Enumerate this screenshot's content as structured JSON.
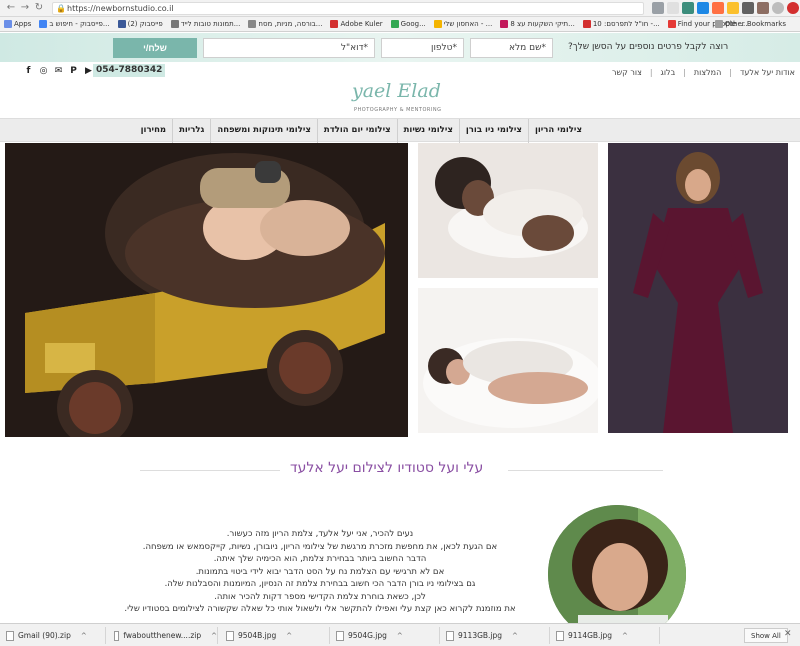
{
  "browser": {
    "url": "https://newbornstudio.co.il",
    "bookmarks": [
      {
        "label": "Apps",
        "color": "#6b8fe8"
      },
      {
        "label": "פייסבוק - חיפוש ב...",
        "color": "#4285f4"
      },
      {
        "label": "(2) פייסבוק",
        "color": "#3b5998"
      },
      {
        "label": "תמונות טובות לייד...",
        "color": "#777777"
      },
      {
        "label": "בורסה, מניות, מסח...",
        "color": "#888888"
      },
      {
        "label": "Adobe Kuler",
        "color": "#d32f2f"
      },
      {
        "label": "Goog...",
        "color": "#34a853"
      },
      {
        "label": "האחסון שלי - ...",
        "color": "#f4b400"
      },
      {
        "label": "8 תיקי השקעות עצ...",
        "color": "#c2185b"
      },
      {
        "label": "חו\"ל לתפרסם: 10 -...",
        "color": "#d32f2f"
      },
      {
        "label": "Find your people -...",
        "color": "#e53935"
      }
    ],
    "other_bookmarks": "Other Bookmarks"
  },
  "lead_form": {
    "question": "רוצה לקבל פרטים נוספים על הסשן שלך?",
    "name_placeholder": "שם מלא*",
    "phone_placeholder": "טלפון*",
    "email_placeholder": "דוא\"ל*",
    "submit_label": "שלח/י"
  },
  "header": {
    "phone": "054-7880342",
    "top_links": [
      "אודות יעל אלעד",
      "המלצות",
      "בלוג",
      "צור קשר"
    ],
    "logo_main": "yael Elad",
    "logo_sub": "PHOTOGRAPHY & MENTORING"
  },
  "nav": {
    "items": [
      "צילומי הריון",
      "צילומי ניו בורן",
      "צילומי נשיות",
      "צילומי יום הולדת",
      "צילומי תינוקות ומשפחה",
      "גלריות",
      "מחירון"
    ]
  },
  "about": {
    "title": "עלי ועל סטודיו לצילום יעל אלעד",
    "paragraphs": [
      "נעים להכיר, אני יעל אלעד, צלמת הריון מזה כעשור.",
      "אם הגעת לכאן, את מחפשת מזכרת מרגשת של צילומי הריון, ניובורן, נשיות, קייקסמאש או משפחה.",
      "הדבר החשוב ביותר בבחירת צלמת, הוא הכימיה שלך איתה.",
      "אם לא תרגישי עם הצלמת נח על הסט הדבר יבוא לידי ביטוי בתמונות.",
      "גם בצילומי ניו בורן הדבר הכי חשוב בבחירת צלמת זה הנסיון, המיומנות והסבלנות שלה.",
      "לכן, כשאת בוחרת צלמת הקדישי מספר דקות להכיר אותה.",
      "את מוזמנת לקרוא כאן קצת עלי ואפילו להתקשר אלי ולשאול אותי כל שאלה שקשורה לצילומים בסטודיו שלי."
    ]
  },
  "downloads": {
    "items": [
      "Gmail (90).zip",
      "fwaboutthenew....zip",
      "9504B.jpg",
      "9504G.jpg",
      "9113GB.jpg",
      "9114GB.jpg"
    ],
    "show_all": "Show All"
  },
  "colors": {
    "accent": "#7ab6ab",
    "title": "#8a4fa3",
    "lead_bg": "#cfe9e3"
  }
}
